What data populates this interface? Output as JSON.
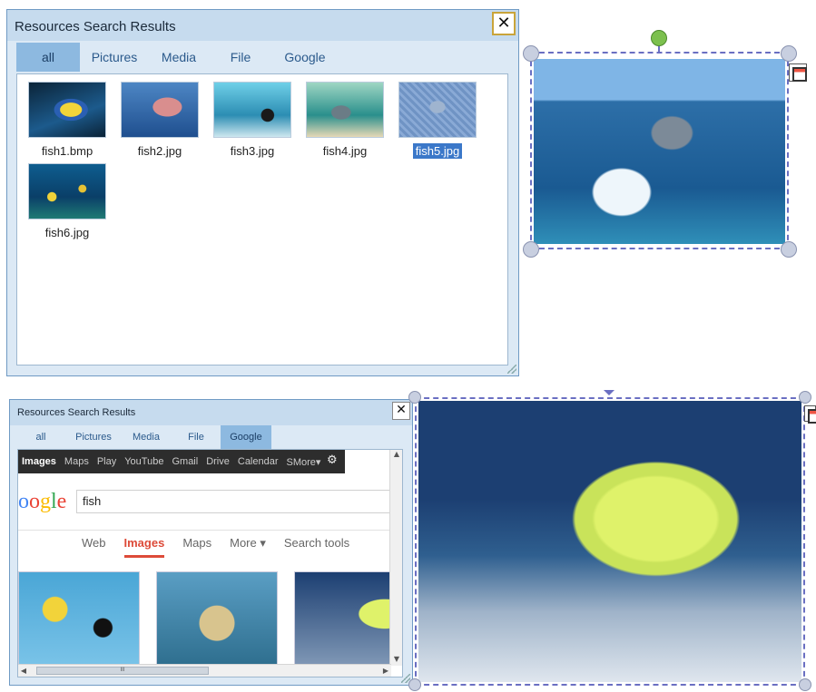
{
  "top_panel": {
    "title": "Resources Search Results",
    "close_glyph": "✕",
    "tabs": [
      {
        "label": "all",
        "active": true
      },
      {
        "label": "Pictures",
        "active": false
      },
      {
        "label": "Media",
        "active": false
      },
      {
        "label": "File",
        "active": false
      },
      {
        "label": "Google",
        "active": false
      }
    ],
    "files": [
      {
        "name": "fish1.bmp",
        "selected": false
      },
      {
        "name": "fish2.jpg",
        "selected": false
      },
      {
        "name": "fish3.jpg",
        "selected": false
      },
      {
        "name": "fish4.jpg",
        "selected": false
      },
      {
        "name": "fish5.jpg",
        "selected": true
      },
      {
        "name": "fish6.jpg",
        "selected": false
      }
    ]
  },
  "bottom_panel": {
    "title": "Resources Search Results",
    "close_glyph": "✕",
    "tabs": [
      {
        "label": "all",
        "active": false
      },
      {
        "label": "Pictures",
        "active": false
      },
      {
        "label": "Media",
        "active": false
      },
      {
        "label": "File",
        "active": false
      },
      {
        "label": "Google",
        "active": true
      }
    ],
    "browser": {
      "topbar": [
        "Images",
        "Maps",
        "Play",
        "YouTube",
        "Gmail",
        "Drive",
        "Calendar",
        "SMore▾"
      ],
      "logo_text": "ogle",
      "query": "fish",
      "search_tabs": [
        {
          "label": "Web",
          "active": false
        },
        {
          "label": "Images",
          "active": true
        },
        {
          "label": "Maps",
          "active": false
        },
        {
          "label": "More ▾",
          "active": false
        },
        {
          "label": "Search tools",
          "active": false
        }
      ],
      "scroll_thumb_grip": "III"
    }
  },
  "icons": {
    "close": "close-icon",
    "settings": "gear-icon",
    "object_menu": "object-menu-icon"
  },
  "colors": {
    "selection_frame": "#6a6fc2",
    "rotate_handle": "#7cc04e",
    "active_tab": "#8db9e0",
    "selected_file": "#3b78c9",
    "google_images_red": "#dd4b39"
  }
}
